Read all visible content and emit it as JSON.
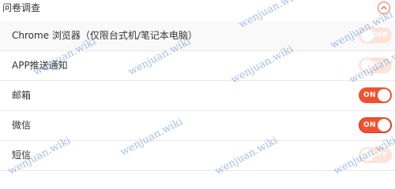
{
  "header": {
    "title": "问卷调查",
    "collapse_icon": "chevron-up-icon"
  },
  "settings": [
    {
      "label": "Chrome 浏览器（仅限台式机/笔记本电脑）",
      "state_text": "OFF",
      "enabled": false
    },
    {
      "label": "APP推送通知",
      "state_text": "OFF",
      "enabled": false
    },
    {
      "label": "邮箱",
      "state_text": "ON",
      "enabled": true
    },
    {
      "label": "微信",
      "state_text": "ON",
      "enabled": true
    },
    {
      "label": "短信",
      "state_text": "OFF",
      "enabled": false
    }
  ],
  "watermark": {
    "text": "wenjuan.wiki"
  },
  "colors": {
    "accent": "#f2512f",
    "toggle_off": "#fde3d8",
    "watermark": "#5a8cd2"
  }
}
